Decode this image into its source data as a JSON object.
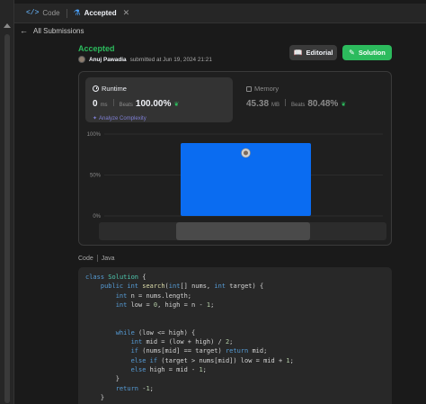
{
  "tabs": [
    {
      "label": "Code",
      "icon": "code-icon",
      "active": false
    },
    {
      "label": "Accepted",
      "icon": "flask-icon",
      "active": true
    }
  ],
  "back_link": "All Submissions",
  "submission": {
    "status": "Accepted",
    "author": "Anuj Pawadia",
    "submitted_text": "submitted at Jun 19, 2024 21:21"
  },
  "buttons": {
    "editorial": "Editorial",
    "solution": "Solution"
  },
  "runtime": {
    "title": "Runtime",
    "value": "0",
    "unit": "ms",
    "beats_label": "Beats",
    "beats_value": "100.00%",
    "analyze_label": "Analyze Complexity"
  },
  "memory": {
    "title": "Memory",
    "value": "45.38",
    "unit": "MB",
    "beats_label": "Beats",
    "beats_value": "80.48%"
  },
  "chart_data": {
    "type": "bar",
    "y_ticks": [
      "100%",
      "50%",
      "0%"
    ],
    "ylim": [
      0,
      100
    ],
    "bars": [
      {
        "value": 89
      }
    ]
  },
  "code": {
    "tabs": [
      "Code",
      "Java"
    ],
    "lines": [
      "class Solution {",
      "    public int search(int[] nums, int target) {",
      "        int n = nums.length;",
      "        int low = 0, high = n - 1;",
      "",
      "",
      "        while (low <= high) {",
      "            int mid = (low + high) / 2;",
      "            if (nums[mid] == target) return mid;",
      "            else if (target > nums[mid]) low = mid + 1;",
      "            else high = mid - 1;",
      "        }",
      "        return -1;",
      "    }"
    ]
  },
  "colors": {
    "accepted": "#2cbb5d",
    "bar": "#0a6cf1",
    "background": "#1a1a1a"
  }
}
